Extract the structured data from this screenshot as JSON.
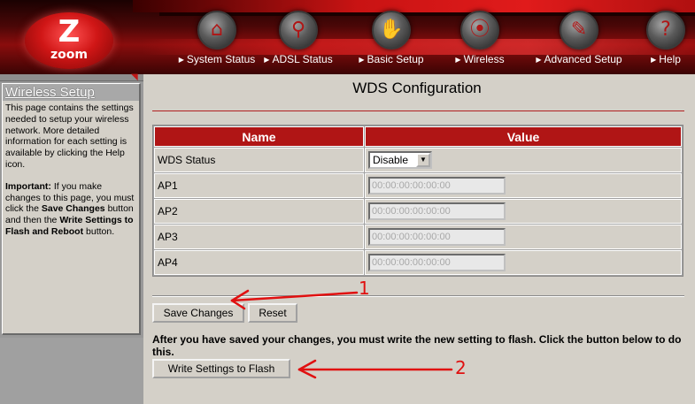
{
  "brand": {
    "logo_letter": "Z",
    "logo_word": "zoom"
  },
  "nav": [
    {
      "label": "System Status",
      "icon": "status-icon",
      "glyph": "⌂"
    },
    {
      "label": "ADSL Status",
      "icon": "magnifier-icon",
      "glyph": "⚲"
    },
    {
      "label": "Basic Setup",
      "icon": "hand-icon",
      "glyph": "✋"
    },
    {
      "label": "Wireless",
      "icon": "wireless-icon",
      "glyph": "⦿"
    },
    {
      "label": "Advanced Setup",
      "icon": "wrench-icon",
      "glyph": "✎"
    },
    {
      "label": "Help",
      "icon": "help-icon",
      "glyph": "?"
    }
  ],
  "sidebar": {
    "title": "Wireless Setup",
    "intro": "This page contains the settings needed to setup your wireless network. More detailed information for each setting is available by clicking the Help icon.",
    "important_label": "Important:",
    "important_text_1": " If you make changes to this page, you must click the ",
    "save_changes": "Save Changes",
    "important_text_2": " button and then the ",
    "write_settings": "Write Settings to Flash and Reboot",
    "important_text_3": " button."
  },
  "main": {
    "title": "WDS Configuration",
    "table": {
      "headers": [
        "Name",
        "Value"
      ],
      "wds_status_label": "WDS Status",
      "wds_status_value": "Disable",
      "aps": [
        {
          "label": "AP1",
          "value": "00:00:00:00:00:00"
        },
        {
          "label": "AP2",
          "value": "00:00:00:00:00:00"
        },
        {
          "label": "AP3",
          "value": "00:00:00:00:00:00"
        },
        {
          "label": "AP4",
          "value": "00:00:00:00:00:00"
        }
      ]
    },
    "save_button": "Save Changes",
    "reset_button": "Reset",
    "flash_note": "After you have saved your changes, you must write the new setting to flash. Click the button below to do this.",
    "write_button": "Write Settings to Flash"
  },
  "annotations": {
    "marker_1": "1",
    "marker_2": "2"
  },
  "colors": {
    "accent": "#b01515",
    "annotation": "#e01010"
  }
}
